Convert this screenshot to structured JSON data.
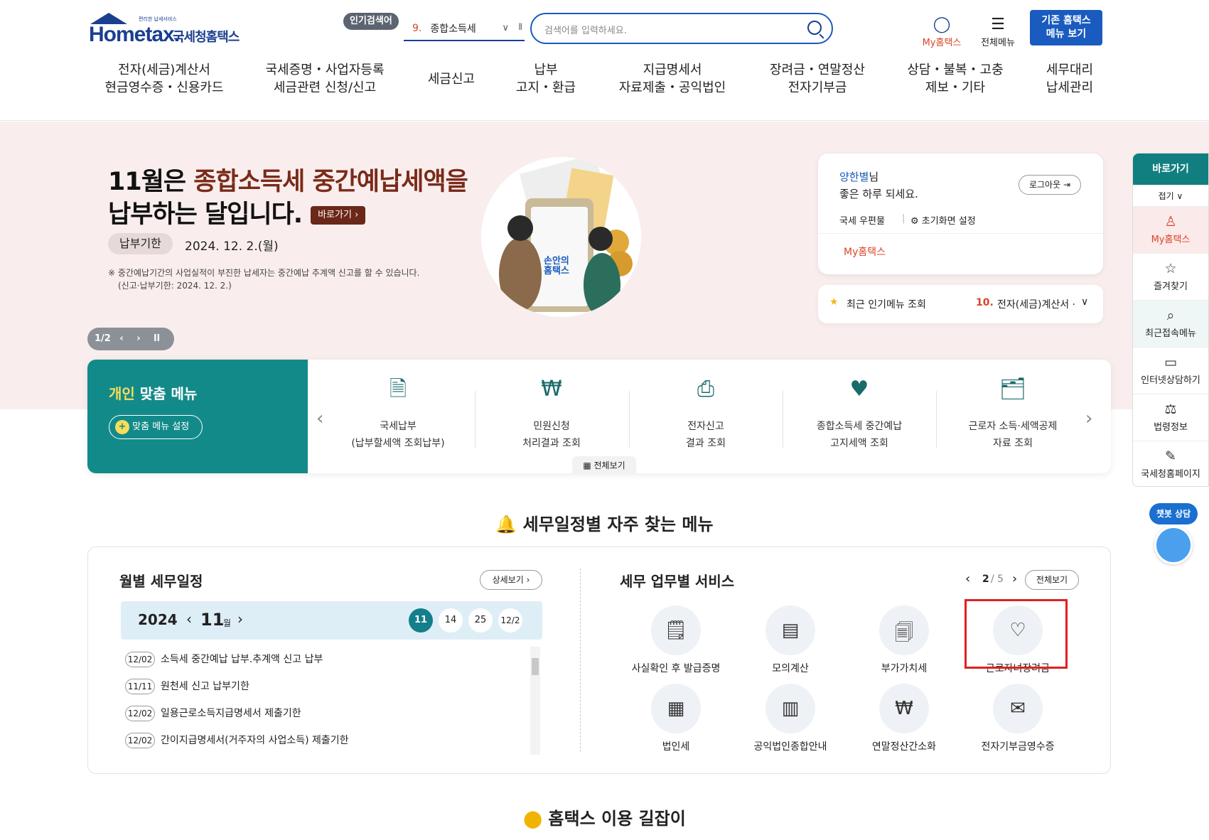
{
  "header": {
    "logo": {
      "brand": "Hometax.",
      "small": "편리한 납세서비스",
      "korean": "국세청홈택스"
    },
    "popular_badge": "인기검색어",
    "popular_num": "9.",
    "popular_term": "종합소득세",
    "search_placeholder": "검색어를 입력하세요.",
    "my_hometax": "My홈택스",
    "all_menu": "전체메뉴",
    "old_menu_line1": "기존 홈택스",
    "old_menu_line2": "메뉴 보기",
    "gnb": [
      {
        "l1": "전자(세금)계산서",
        "l2": "현금영수증・신용카드"
      },
      {
        "l1": "국세증명・사업자등록",
        "l2": "세금관련 신청/신고"
      },
      {
        "l1": "세금신고",
        "l2": ""
      },
      {
        "l1": "납부",
        "l2": "고지・환급"
      },
      {
        "l1": "지급명세서",
        "l2": "자료제출・공익법인"
      },
      {
        "l1": "장려금・연말정산",
        "l2": "전자기부금"
      },
      {
        "l1": "상담・불복・고충",
        "l2": "제보・기타"
      },
      {
        "l1": "세무대리",
        "l2": "납세관리"
      }
    ]
  },
  "banner": {
    "title_pre": "11월은 ",
    "title_hl": "종합소득세 중간예납세액을",
    "title_line2": "납부하는 달입니다.",
    "go_label": "바로가기 ›",
    "due_label": "납부기한",
    "due_date": "2024. 12. 2.(월)",
    "note1": "※ 중간예납기간의 사업실적이 부진한 납세자는 중간예납 추계액 신고를 할 수 있습니다.",
    "note2": "(신고·납부기한: 2024. 12. 2.)",
    "illus_text": "손안의 홈택스",
    "slide": "1/2"
  },
  "login": {
    "user": "양한별",
    "user_suffix": "님",
    "greeting": "좋은 하루 되세요.",
    "logout": "로그아웃",
    "mailbox": "국세 우편물",
    "reset": "초기화면 설정",
    "my_hometax": "My홈택스"
  },
  "popular_menu": {
    "label": "최근 인기메뉴 조회",
    "num": "10.",
    "item": "전자(세금)계산서 ·"
  },
  "quick_menu": {
    "title_1": "개인",
    "title_2": " 맞춤 메뉴",
    "setting": "맞춤 메뉴 설정",
    "items": [
      {
        "l1": "국세납부",
        "l2": "(납부할세액 조회납부)"
      },
      {
        "l1": "민원신청",
        "l2": "처리결과 조회"
      },
      {
        "l1": "전자신고",
        "l2": "결과 조회"
      },
      {
        "l1": "종합소득세 중간예납",
        "l2": "고지세액 조회"
      },
      {
        "l1": "근로자 소득·세액공제",
        "l2": "자료 조회"
      }
    ],
    "view_all": "전체보기"
  },
  "rail": {
    "head": "바로가기",
    "fold": "접기",
    "items": [
      "My홈택스",
      "즐겨찾기",
      "최근접속메뉴",
      "인터넷상담하기",
      "법령정보",
      "국세청홈페이지"
    ],
    "chatbot": "챗봇 상담"
  },
  "section_title": "세무일정별 자주 찾는 메뉴",
  "schedule": {
    "title": "월별 세무일정",
    "detail": "상세보기",
    "year": "2024",
    "month": "11",
    "month_unit": "월",
    "days": [
      "11",
      "14",
      "25",
      "12/2"
    ],
    "rows": [
      {
        "d": "12/02",
        "t": "소득세 중간예납 납부.추계액 신고 납부"
      },
      {
        "d": "11/11",
        "t": "원천세 신고 납부기한"
      },
      {
        "d": "12/02",
        "t": "일용근로소득지급명세서 제출기한"
      },
      {
        "d": "12/02",
        "t": "간이지급명세서(거주자의 사업소득) 제출기한"
      }
    ]
  },
  "services": {
    "title": "세무 업무별 서비스",
    "page": "2",
    "total": "/ 5",
    "view_all": "전체보기",
    "items": [
      "사실확인 후 발급증명",
      "모의계산",
      "부가가치세",
      "근로자녀장려금",
      "법인세",
      "공익법인종합안내",
      "연말정산간소화",
      "전자기부금영수증"
    ],
    "highlighted": "근로자녀장려금"
  },
  "guide_title": "홈택스 이용 길잡이",
  "colors": {
    "brand": "#1a3f8f",
    "teal": "#138a8a",
    "highlight": "#e02020",
    "banner_bg": "#f9eeed"
  }
}
